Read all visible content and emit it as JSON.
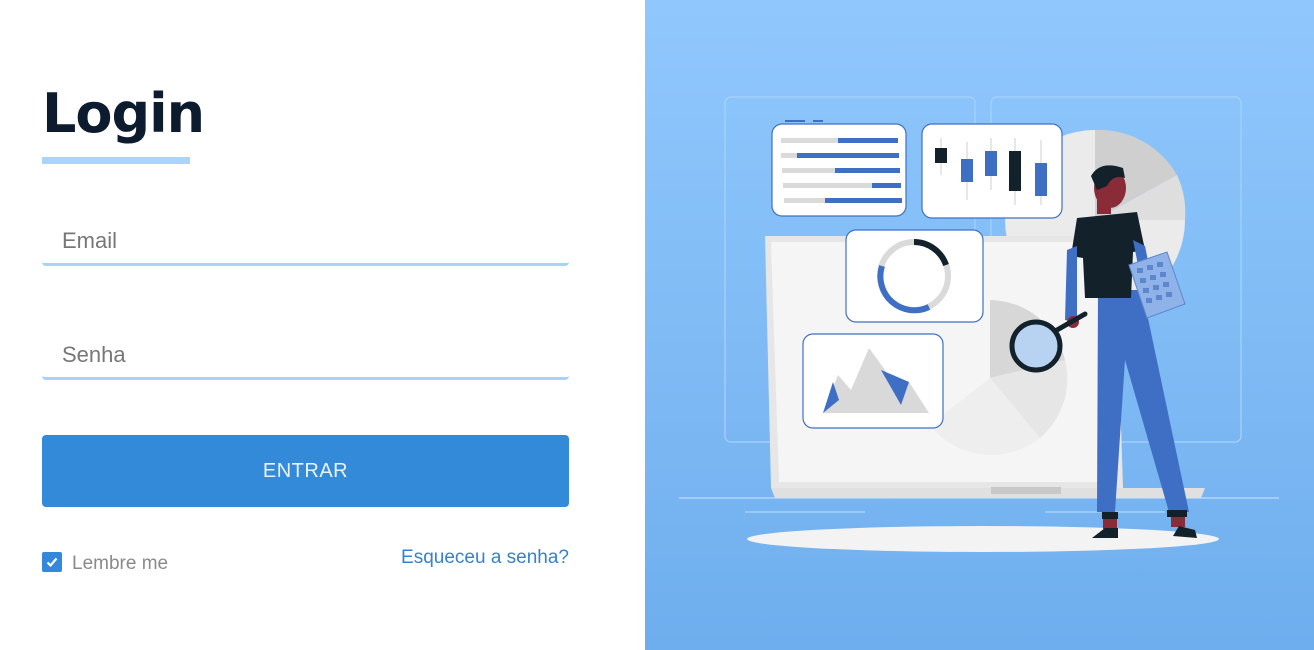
{
  "login": {
    "title": "Login",
    "email_placeholder": "Email",
    "password_placeholder": "Senha",
    "submit_label": "ENTRAR",
    "remember_label": "Lembre me",
    "remember_checked": true,
    "forgot_label": "Esqueceu a senha?"
  },
  "colors": {
    "accent": "#338ad9",
    "underline": "#a9d4fb",
    "panel_bg": "#90c8fd",
    "title": "#0d1b2e"
  },
  "illustration": {
    "subject": "person-with-magnifying-glass-analyzing-charts"
  }
}
